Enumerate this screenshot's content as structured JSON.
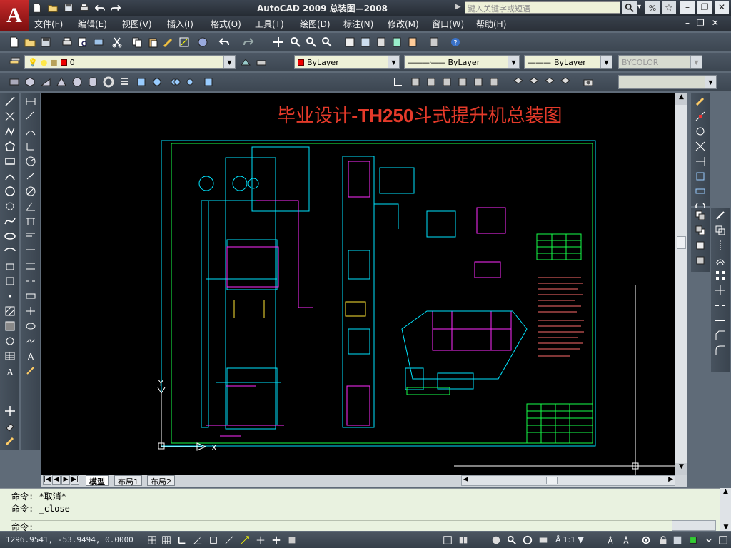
{
  "app": {
    "title": "AutoCAD 2009  总装图—2008",
    "logo_letter": "A",
    "search_placeholder": "键入关键字或短语"
  },
  "menu": [
    "文件(F)",
    "编辑(E)",
    "视图(V)",
    "插入(I)",
    "格式(O)",
    "工具(T)",
    "绘图(D)",
    "标注(N)",
    "修改(M)",
    "窗口(W)",
    "帮助(H)"
  ],
  "layers": {
    "current_layer": "0",
    "color": "ByLayer",
    "linetype": "ByLayer",
    "lineweight": "ByLayer",
    "plotstyle": "BYCOLOR"
  },
  "drawing": {
    "title_prefix": "毕业设计-",
    "title_code": "TH250",
    "title_suffix": "斗式提升机总装图"
  },
  "layout_tabs": [
    "模型",
    "布局1",
    "布局2"
  ],
  "active_tab": "模型",
  "command": {
    "history": [
      "命令: *取消*",
      "命令: _close"
    ],
    "prompt": "命令:"
  },
  "status": {
    "coordinates": "1296.9541, -53.9494, 0.0000",
    "scale": "1:1"
  },
  "colors": {
    "title_red": "#e43a2a",
    "cyan": "#00e5ff",
    "magenta": "#ff2bff",
    "green": "#16ff4a",
    "yellow": "#ffe633"
  }
}
